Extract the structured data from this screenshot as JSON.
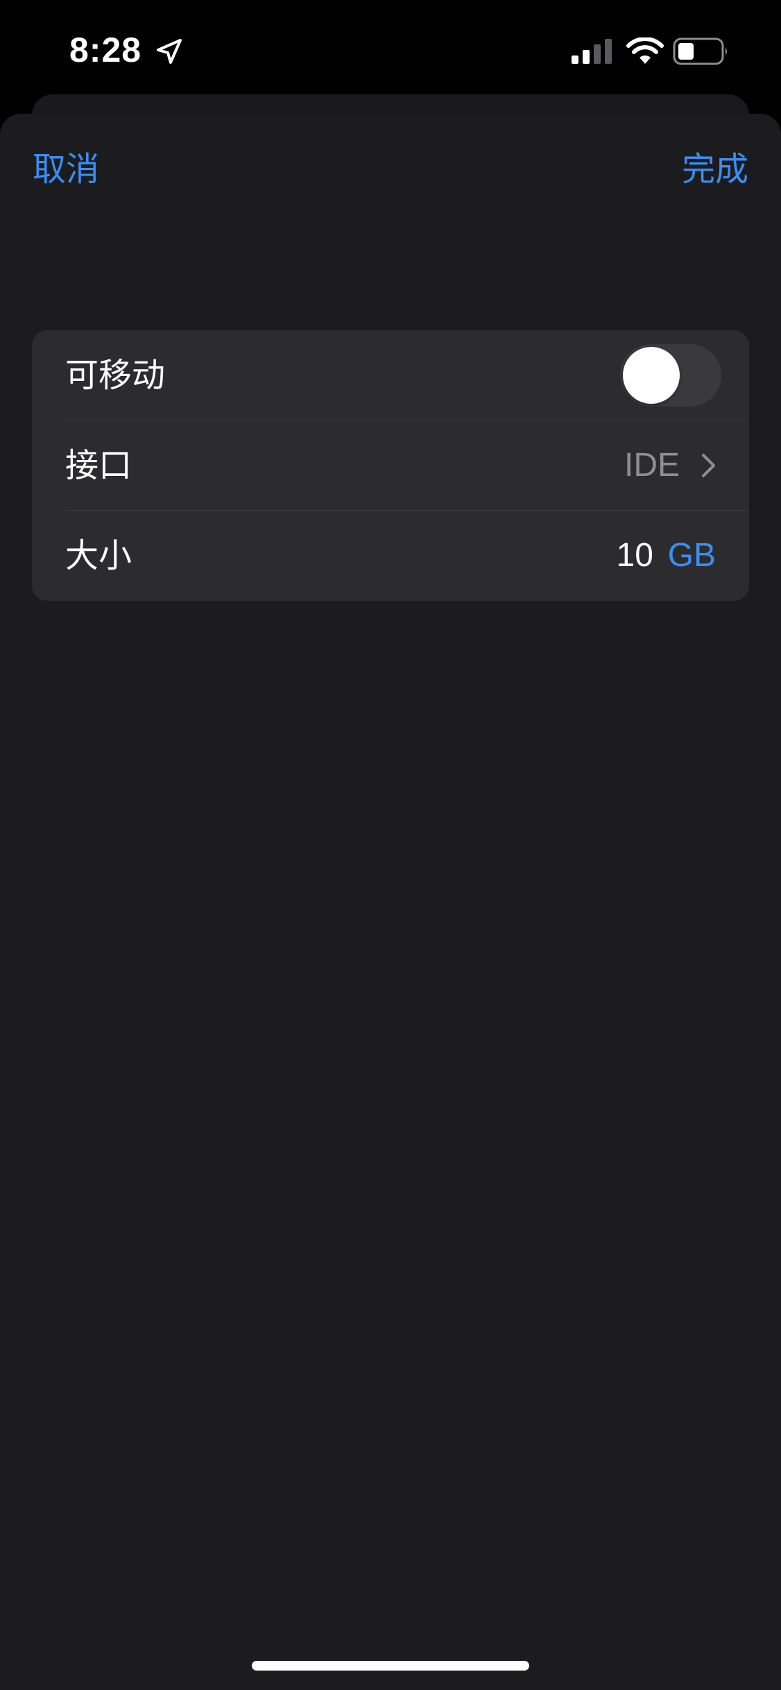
{
  "status_bar": {
    "time": "8:28",
    "icons": [
      "location-arrow-icon",
      "cellular-signal-icon",
      "wifi-icon",
      "battery-icon"
    ]
  },
  "nav": {
    "cancel_label": "取消",
    "done_label": "完成"
  },
  "settings": {
    "removable": {
      "label": "可移动",
      "enabled": false
    },
    "interface": {
      "label": "接口",
      "value": "IDE",
      "icon": "chevron-right-icon"
    },
    "size": {
      "label": "大小",
      "value": "10",
      "unit": "GB"
    }
  },
  "colors": {
    "accent": "#3a8ef2",
    "background": "#1c1c1e",
    "group_background": "#2c2c2e",
    "secondary_text": "#8e8e93",
    "toggle_off": "#3a3a3c"
  }
}
